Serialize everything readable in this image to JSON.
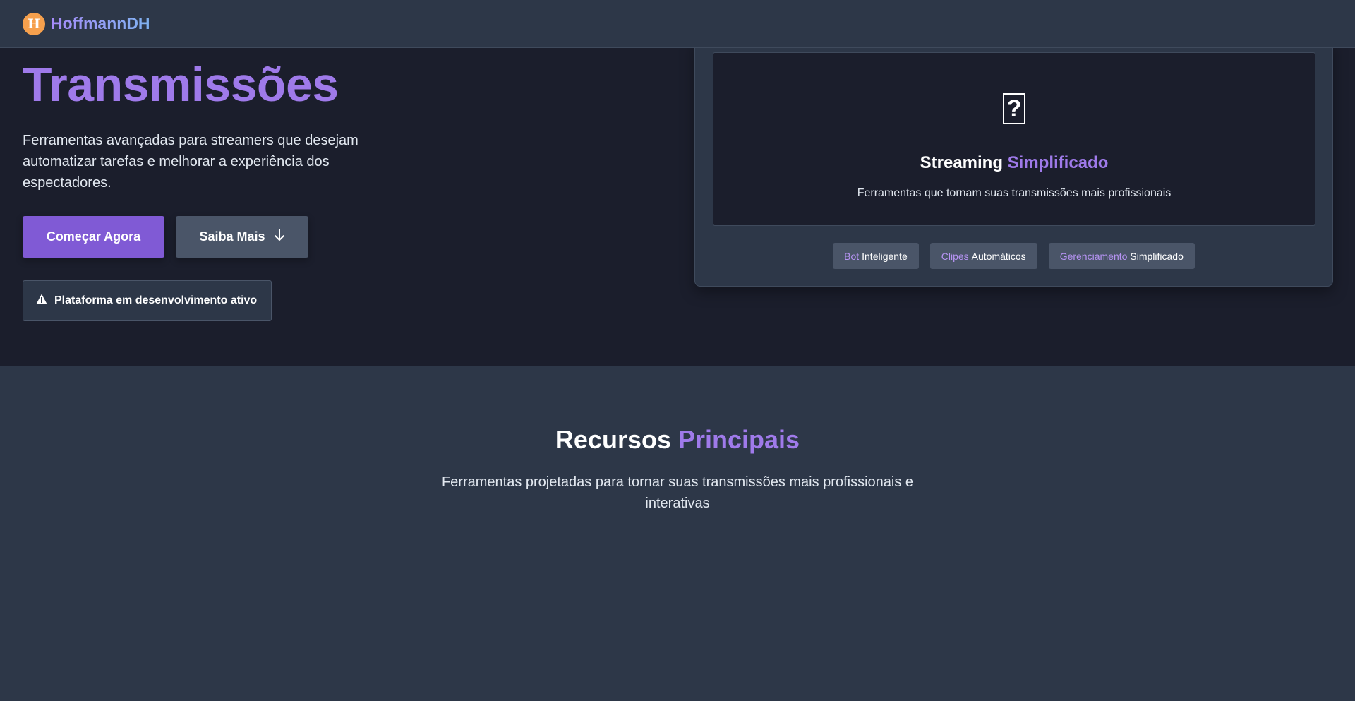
{
  "nav": {
    "logo_letter": "H",
    "brand": "HoffmannDH"
  },
  "hero": {
    "title": "Transmissões",
    "description": "Ferramentas avançadas para streamers que desejam automatizar tarefas e melhorar a experiência dos espectadores.",
    "primary_button": "Começar Agora",
    "secondary_button": "Saiba Mais",
    "dev_notice": "Plataforma em desenvolvimento ativo"
  },
  "showcase": {
    "icon": "question-icon",
    "title_main": "Streaming",
    "title_accent": "Simplificado",
    "subtitle": "Ferramentas que tornam suas transmissões mais profissionais",
    "tags": [
      {
        "highlight": "Bot",
        "text": "Inteligente"
      },
      {
        "highlight": "Clipes",
        "text": "Automáticos"
      },
      {
        "highlight": "Gerenciamento",
        "text": "Simplificado"
      }
    ]
  },
  "features": {
    "title_main": "Recursos",
    "title_accent": "Principais",
    "description": "Ferramentas projetadas para tornar suas transmissões mais profissionais e interativas"
  },
  "colors": {
    "accent": "#9f7aea",
    "primary_button": "#805ad5",
    "logo": "#f6a04d",
    "hero_bg": "#1b1e2c",
    "section_bg": "#2d3748"
  }
}
